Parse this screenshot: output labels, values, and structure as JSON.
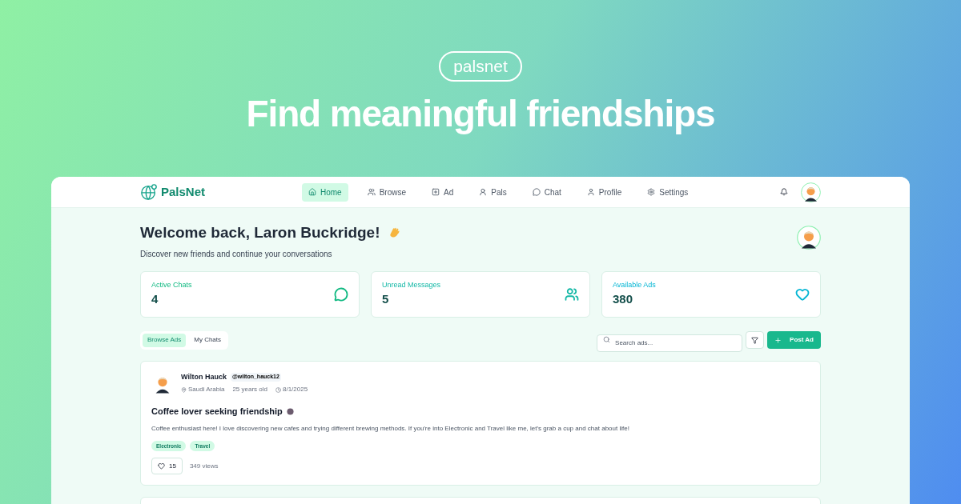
{
  "hero": {
    "badge": "palsnet",
    "title": "Find meaningful friendships"
  },
  "nav": {
    "brand": "PalsNet",
    "items": [
      {
        "label": "Home",
        "selected": true
      },
      {
        "label": "Browse",
        "selected": false
      },
      {
        "label": "Ad",
        "selected": false
      },
      {
        "label": "Pals",
        "selected": false
      },
      {
        "label": "Chat",
        "selected": false
      },
      {
        "label": "Profile",
        "selected": false
      },
      {
        "label": "Settings",
        "selected": false
      }
    ]
  },
  "welcome": {
    "title": "Welcome back, Laron Buckridge!",
    "subtitle": "Discover new friends and continue your conversations"
  },
  "stats": [
    {
      "label": "Active Chats",
      "value": "4",
      "color": "#10b981"
    },
    {
      "label": "Unread Messages",
      "value": "5",
      "color": "#14b8a6"
    },
    {
      "label": "Available Ads",
      "value": "380",
      "color": "#06b6d4"
    }
  ],
  "tabs": [
    {
      "label": "Browse Ads",
      "selected": true
    },
    {
      "label": "My Chats",
      "selected": false
    }
  ],
  "search": {
    "placeholder": "Search ads..."
  },
  "post_button": "Post Ad",
  "posts": [
    {
      "name": "Wilton Hauck",
      "handle": "@wilton_hauck12",
      "location": "Saudi Arabia",
      "age": "25 years old",
      "date": "8/1/2025",
      "title": "Coffee lover seeking friendship",
      "body": "Coffee enthusiast here! I love discovering new cafes and trying different brewing methods. If you're into Electronic and Travel like me, let's grab a cup and chat about life!",
      "tags": [
        "Electronic",
        "Travel"
      ],
      "likes": "15",
      "views": "349 views"
    }
  ]
}
